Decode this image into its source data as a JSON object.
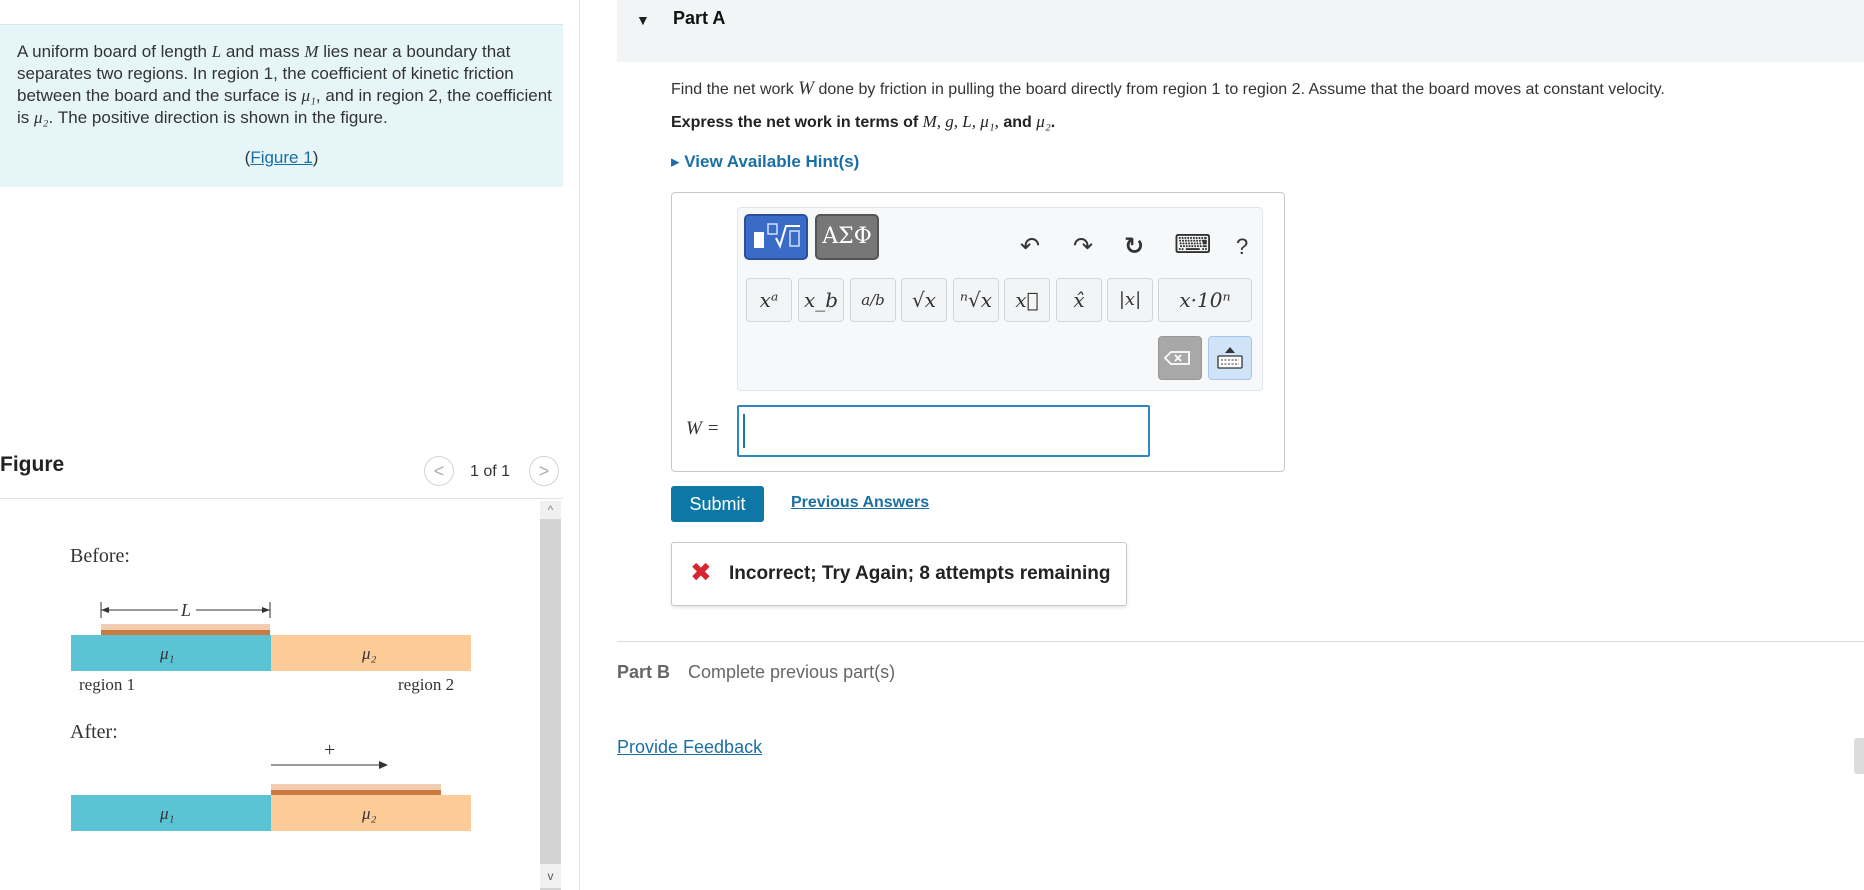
{
  "problem": {
    "text_parts": [
      "A uniform board of length ",
      "L",
      " and mass ",
      "M",
      " lies near a boundary that separates two regions. In region 1, the coefficient of kinetic friction between the board and the surface is ",
      "μ₁",
      ", and in region 2, the coefficient is ",
      "μ₂",
      ". The positive direction is shown in the figure."
    ],
    "figure_link": "Figure 1"
  },
  "figure_panel": {
    "title": "Figure",
    "counter": "1 of 1",
    "prev": "<",
    "next": ">",
    "scroll_up": "^",
    "scroll_down": "v",
    "labels": {
      "before": "Before:",
      "after": "After:",
      "length": "L",
      "mu1": "μ₁",
      "mu2": "μ₂",
      "region1": "region 1",
      "region2": "region 2",
      "plus": "+"
    },
    "colors": {
      "region1": "#5bc3d4",
      "region2": "#fdcb98",
      "board_light": "#f3cdb0",
      "board_dark": "#c97a3c"
    }
  },
  "part_a": {
    "caret": "▼",
    "title": "Part A",
    "question_parts": [
      "Find the net work ",
      "W",
      " done by friction in pulling the board directly from region 1 to region 2. Assume that the board moves at constant velocity."
    ],
    "express_parts": [
      "Express the net work in terms of ",
      "M, g, L, μ₁,",
      " and ",
      "μ₂",
      "."
    ],
    "hints": "▸ View Available Hint(s)",
    "toolbar": {
      "greek_label": "ΑΣΦ",
      "undo_icon": "↶",
      "redo_icon": "↷",
      "reset_icon": "↻",
      "keyboard_icon": "⌨",
      "help": "?",
      "symbols": [
        "xᵃ",
        "x_b",
        "a/b",
        "√x",
        "ⁿ√x",
        "x⃗",
        "x̂",
        "|x|",
        "x·10ⁿ"
      ]
    },
    "answer_label": "W =",
    "answer_value": "",
    "submit": "Submit",
    "previous_answers": "Previous Answers",
    "feedback_icon": "✖",
    "feedback": "Incorrect; Try Again; 8 attempts remaining"
  },
  "part_b": {
    "label": "Part B",
    "status": "Complete previous part(s)"
  },
  "provide_feedback": "Provide Feedback"
}
